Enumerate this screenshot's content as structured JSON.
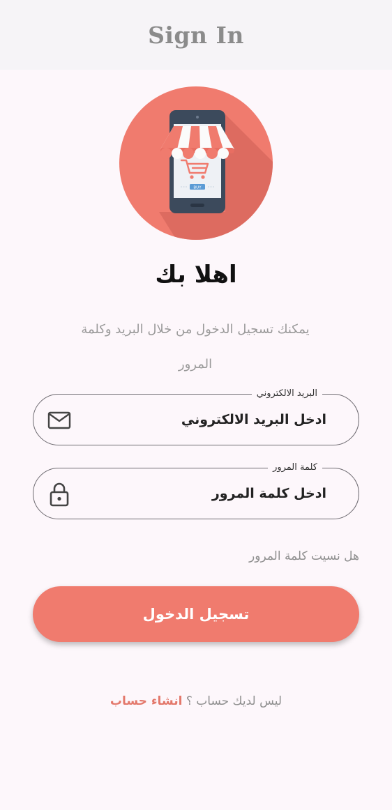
{
  "appbar": {
    "title": "Sign In"
  },
  "logo": {
    "icon": "shop-phone-logo",
    "badge_text": "BUY"
  },
  "welcome": {
    "title": "اهلا بك"
  },
  "subtitle": {
    "text": "يمكنك تسجيل الدخول من خلال البريد وكلمة المرور"
  },
  "email": {
    "label": "البريد الالكتروني",
    "placeholder": "ادخل البريد الالكتروني",
    "icon": "mail-icon"
  },
  "password": {
    "label": "كلمة المرور",
    "placeholder": "ادخل كلمة المرور",
    "icon": "lock-icon"
  },
  "forgot_password": {
    "text": "هل نسيت كلمة المرور"
  },
  "login_button": {
    "label": "تسجيل الدخول"
  },
  "signup": {
    "question": "ليس لديك حساب ؟",
    "link": "انشاء حساب"
  },
  "colors": {
    "accent": "#f07b6e",
    "background": "#fdf7fb",
    "appbar": "#f6f4f7"
  }
}
